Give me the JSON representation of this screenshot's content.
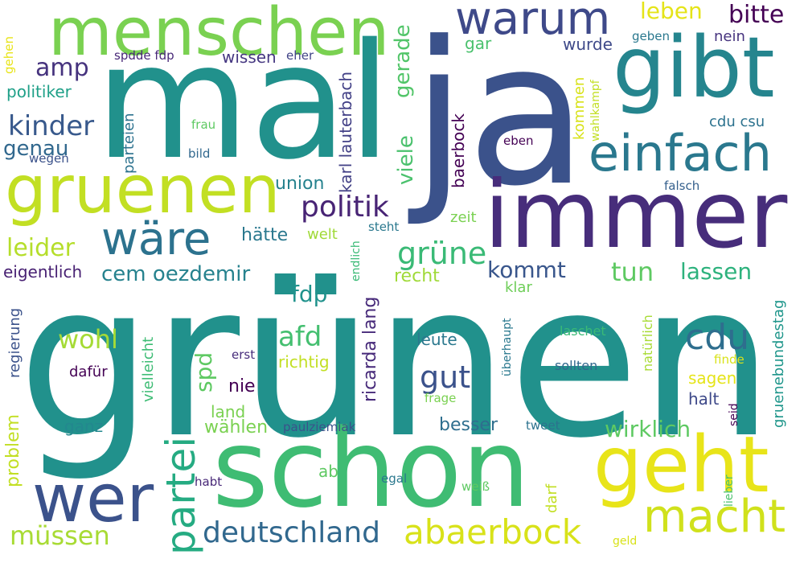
{
  "words": [
    {
      "id": "w-gruenen-big",
      "text": "grünen",
      "color": "#21918c"
    },
    {
      "id": "w-mal",
      "text": "mal",
      "color": "#21918c"
    },
    {
      "id": "w-ja",
      "text": "ja",
      "color": "#3b528b"
    },
    {
      "id": "w-schon",
      "text": "schon",
      "color": "#3fbc73"
    },
    {
      "id": "w-immer",
      "text": "immer",
      "color": "#472d7b"
    },
    {
      "id": "w-gibt",
      "text": "gibt",
      "color": "#25858e"
    },
    {
      "id": "w-menschen",
      "text": "menschen",
      "color": "#7ad151"
    },
    {
      "id": "w-gruenen",
      "text": "gruenen",
      "color": "#c2df23"
    },
    {
      "id": "w-geht",
      "text": "geht",
      "color": "#e8e419"
    },
    {
      "id": "w-wer",
      "text": "wer",
      "color": "#3b528b"
    },
    {
      "id": "w-einfach",
      "text": "einfach",
      "color": "#2a788e"
    },
    {
      "id": "w-warum",
      "text": "warum",
      "color": "#3e4989"
    },
    {
      "id": "w-waere",
      "text": "wäre",
      "color": "#2c728e"
    },
    {
      "id": "w-macht",
      "text": "macht",
      "color": "#d0e11c"
    },
    {
      "id": "w-partei",
      "text": "partei",
      "color": "#25ab82"
    },
    {
      "id": "w-abaerbock",
      "text": "abaerbock",
      "color": "#d8e219"
    },
    {
      "id": "w-deutschland",
      "text": "deutschland",
      "color": "#31688e"
    },
    {
      "id": "w-cdu",
      "text": "cdu",
      "color": "#2e6e8e"
    },
    {
      "id": "w-afd",
      "text": "afd",
      "color": "#44bf70"
    },
    {
      "id": "w-gut",
      "text": "gut",
      "color": "#3b528b"
    },
    {
      "id": "w-gruene",
      "text": "grüne",
      "color": "#3aba76"
    },
    {
      "id": "w-kinder",
      "text": "kinder",
      "color": "#38598c"
    },
    {
      "id": "w-politik",
      "text": "politik",
      "color": "#482475"
    },
    {
      "id": "w-muessen",
      "text": "müssen",
      "color": "#a8db34"
    },
    {
      "id": "w-wirklich",
      "text": "wirklich",
      "color": "#5ec962"
    },
    {
      "id": "w-amp",
      "text": "amp",
      "color": "#46337e"
    },
    {
      "id": "w-bitte",
      "text": "bitte",
      "color": "#440154"
    },
    {
      "id": "w-tun",
      "text": "tun",
      "color": "#5ec962"
    },
    {
      "id": "w-lassen",
      "text": "lassen",
      "color": "#2db27d"
    },
    {
      "id": "w-leider",
      "text": "leider",
      "color": "#b5de2b"
    },
    {
      "id": "w-wohl",
      "text": "wohl",
      "color": "#a5db36"
    },
    {
      "id": "w-kommt",
      "text": "kommt",
      "color": "#39568c"
    },
    {
      "id": "w-cem",
      "text": "cem oezdemir",
      "color": "#26828e"
    },
    {
      "id": "w-leben",
      "text": "leben",
      "color": "#e5e419"
    },
    {
      "id": "w-genau",
      "text": "genau",
      "color": "#31688e"
    },
    {
      "id": "w-gerade",
      "text": "gerade",
      "color": "#52c569"
    },
    {
      "id": "w-viele",
      "text": "viele",
      "color": "#4ac16d"
    },
    {
      "id": "w-fdp",
      "text": "fdp",
      "color": "#20928c"
    },
    {
      "id": "w-ricarda",
      "text": "ricarda lang",
      "color": "#472a7a"
    },
    {
      "id": "w-spd",
      "text": "spd",
      "color": "#5ec962"
    },
    {
      "id": "w-baerbock",
      "text": "baerbock",
      "color": "#440154"
    },
    {
      "id": "w-karl",
      "text": "karl lauterbach",
      "color": "#424086"
    },
    {
      "id": "w-eigentlich",
      "text": "eigentlich",
      "color": "#482173"
    },
    {
      "id": "w-wissen",
      "text": "wissen",
      "color": "#453781"
    },
    {
      "id": "w-union",
      "text": "union",
      "color": "#26828e"
    },
    {
      "id": "w-haette",
      "text": "hätte",
      "color": "#2a788e"
    },
    {
      "id": "w-problem",
      "text": "problem",
      "color": "#c2df23"
    },
    {
      "id": "w-vielleicht",
      "text": "vielleicht",
      "color": "#3dbc74"
    },
    {
      "id": "w-recht",
      "text": "recht",
      "color": "#a0da39"
    },
    {
      "id": "w-parteien",
      "text": "parteien",
      "color": "#2c728e"
    },
    {
      "id": "w-politiker",
      "text": "politiker",
      "color": "#1fa088"
    },
    {
      "id": "w-gruenebundestag",
      "text": "gruenebundestag",
      "color": "#1f968b"
    },
    {
      "id": "w-besser",
      "text": "besser",
      "color": "#2e6e8e"
    },
    {
      "id": "w-waehlen",
      "text": "wählen",
      "color": "#7ad151"
    },
    {
      "id": "w-ganz",
      "text": "ganz",
      "color": "#23888e"
    },
    {
      "id": "w-dafuer",
      "text": "dafür",
      "color": "#440154"
    },
    {
      "id": "w-leute",
      "text": "leute",
      "color": "#2a788e"
    },
    {
      "id": "w-nie",
      "text": "nie",
      "color": "#440154"
    },
    {
      "id": "w-land",
      "text": "land",
      "color": "#7ad151"
    },
    {
      "id": "w-sagen",
      "text": "sagen",
      "color": "#e5e419"
    },
    {
      "id": "w-halt",
      "text": "halt",
      "color": "#3e4989"
    },
    {
      "id": "w-regierung",
      "text": "regierung",
      "color": "#3b528b"
    },
    {
      "id": "w-wurde",
      "text": "wurde",
      "color": "#3e4989"
    },
    {
      "id": "w-richtig",
      "text": "richtig",
      "color": "#c2df23"
    },
    {
      "id": "w-cducsu",
      "text": "cdu csu",
      "color": "#2c728e"
    },
    {
      "id": "w-nein",
      "text": "nein",
      "color": "#46337e"
    },
    {
      "id": "w-gar",
      "text": "gar",
      "color": "#4ac16d"
    },
    {
      "id": "w-kommen",
      "text": "kommen",
      "color": "#d8e219"
    },
    {
      "id": "w-welt",
      "text": "welt",
      "color": "#a0da39"
    },
    {
      "id": "w-zeit",
      "text": "zeit",
      "color": "#7ad151"
    },
    {
      "id": "w-klar",
      "text": "klar",
      "color": "#6ece58"
    },
    {
      "id": "w-natuerlich",
      "text": "natürlich",
      "color": "#a8db34"
    },
    {
      "id": "w-darf",
      "text": "darf",
      "color": "#c2df23"
    },
    {
      "id": "w-ab",
      "text": "ab",
      "color": "#5ec962"
    },
    {
      "id": "w-sollten",
      "text": "sollten",
      "color": "#31688e"
    },
    {
      "id": "w-laschet",
      "text": "laschet",
      "color": "#3aba76"
    },
    {
      "id": "w-spddefdp",
      "text": "spdde fdp",
      "color": "#482878"
    },
    {
      "id": "w-eher",
      "text": "eher",
      "color": "#414487"
    },
    {
      "id": "w-geben",
      "text": "geben",
      "color": "#2a788e"
    },
    {
      "id": "w-frau",
      "text": "frau",
      "color": "#5ec962"
    },
    {
      "id": "w-bild",
      "text": "bild",
      "color": "#31688e"
    },
    {
      "id": "w-wegen",
      "text": "wegen",
      "color": "#3b528b"
    },
    {
      "id": "w-gehen",
      "text": "gehen",
      "color": "#e8e419"
    },
    {
      "id": "w-eben",
      "text": "eben",
      "color": "#440154"
    },
    {
      "id": "w-wahlkampf",
      "text": "wahlkampf",
      "color": "#c2df23"
    },
    {
      "id": "w-falsch",
      "text": "falsch",
      "color": "#35608d"
    },
    {
      "id": "w-steht",
      "text": "steht",
      "color": "#2a788e"
    },
    {
      "id": "w-endlich",
      "text": "endlich",
      "color": "#3aba76"
    },
    {
      "id": "w-erst",
      "text": "erst",
      "color": "#472d7b"
    },
    {
      "id": "w-frage",
      "text": "frage",
      "color": "#7ad151"
    },
    {
      "id": "w-ueberhaupt",
      "text": "überhaupt",
      "color": "#2a788e"
    },
    {
      "id": "w-finde",
      "text": "finde",
      "color": "#d8e219"
    },
    {
      "id": "w-seid",
      "text": "seid",
      "color": "#440154"
    },
    {
      "id": "w-tweet",
      "text": "tweet",
      "color": "#2c728e"
    },
    {
      "id": "w-paulziemiak",
      "text": "paulziemiak",
      "color": "#3b528b"
    },
    {
      "id": "w-egal",
      "text": "egal",
      "color": "#2a788e"
    },
    {
      "id": "w-weiss",
      "text": "weiß",
      "color": "#5ec962"
    },
    {
      "id": "w-habt",
      "text": "habt",
      "color": "#482878"
    },
    {
      "id": "w-lieber",
      "text": "lieber",
      "color": "#4ac16d"
    },
    {
      "id": "w-geld",
      "text": "geld",
      "color": "#d8e219"
    }
  ]
}
